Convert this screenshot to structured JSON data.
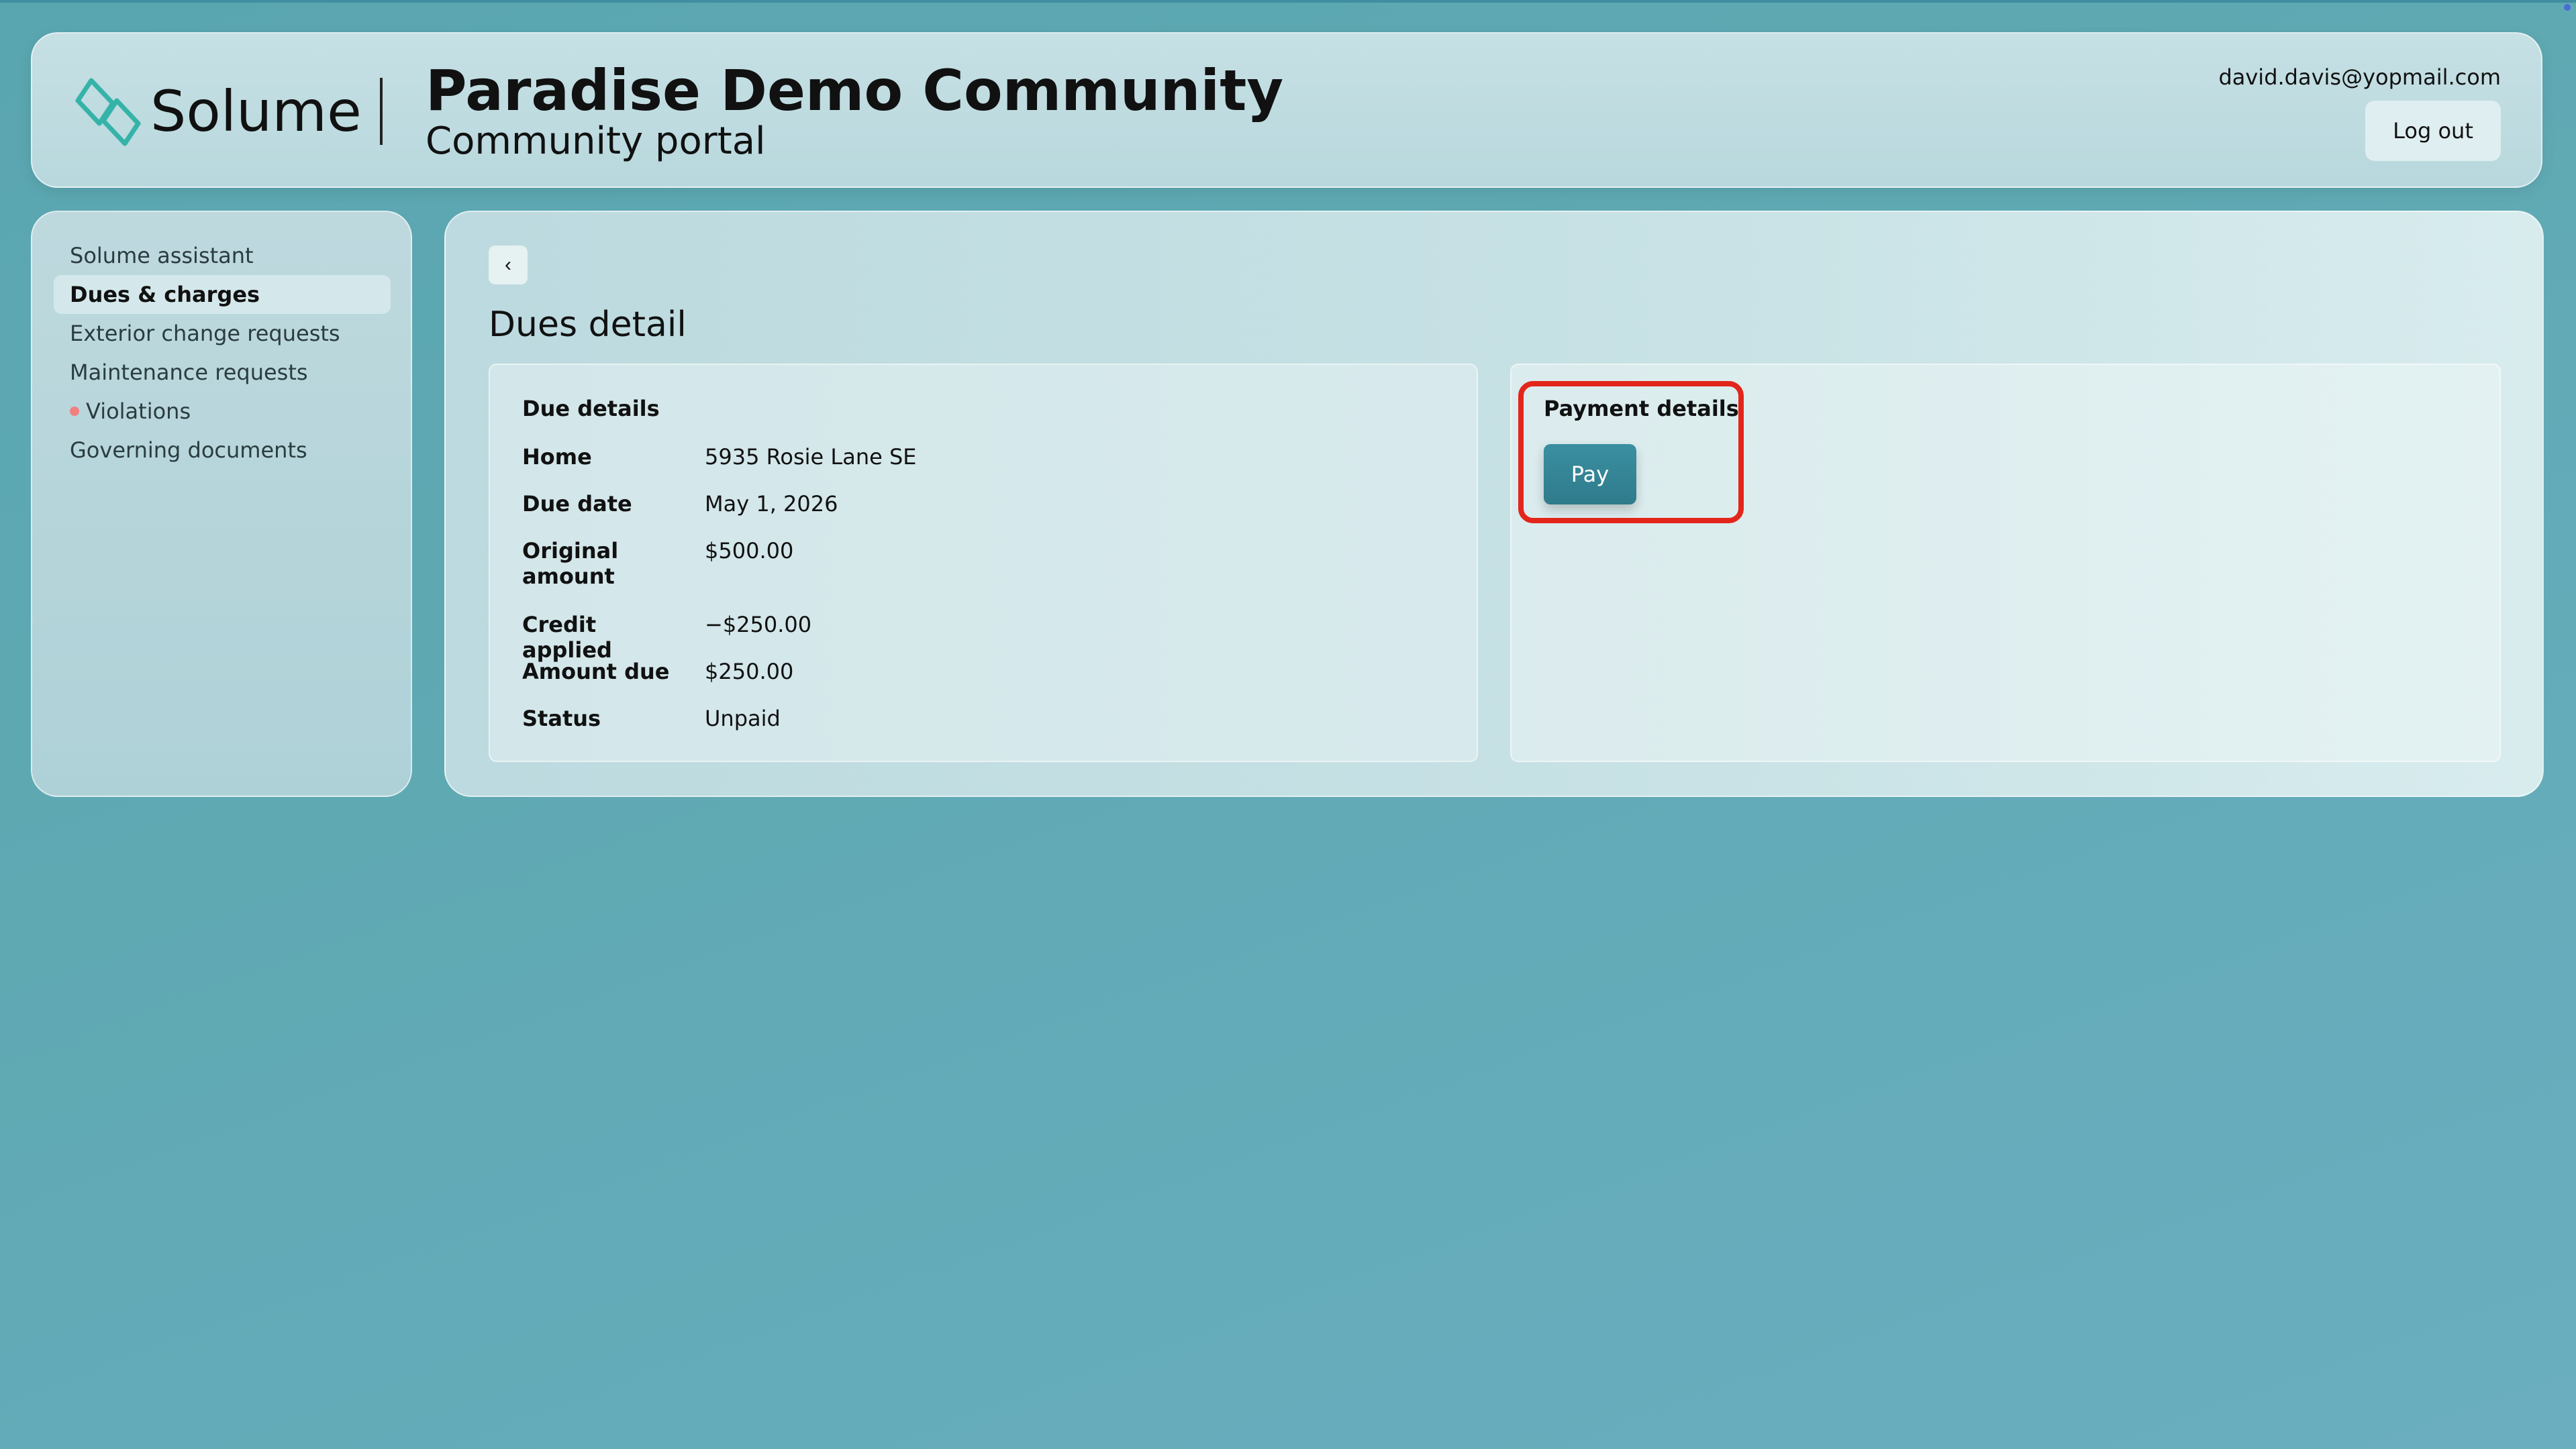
{
  "header": {
    "brand": "Solume",
    "title": "Paradise Demo Community",
    "subtitle": "Community portal",
    "email": "david.davis@yopmail.com",
    "logout_label": "Log out"
  },
  "sidebar": {
    "items": [
      {
        "label": "Solume assistant"
      },
      {
        "label": "Dues & charges"
      },
      {
        "label": "Exterior change requests"
      },
      {
        "label": "Maintenance requests"
      },
      {
        "label": "Violations"
      },
      {
        "label": "Governing documents"
      }
    ]
  },
  "main": {
    "back_label": "‹",
    "page_title": "Dues detail",
    "due_details": {
      "heading": "Due details",
      "rows": [
        {
          "label": "Home",
          "value": "5935 Rosie Lane SE"
        },
        {
          "label": "Due date",
          "value": "May 1, 2026"
        },
        {
          "label": "Original amount",
          "value": "$500.00"
        },
        {
          "label": "Credit applied",
          "value": "−$250.00"
        },
        {
          "label": "Amount due",
          "value": "$250.00"
        },
        {
          "label": "Status",
          "value": "Unpaid"
        }
      ]
    },
    "payment_details": {
      "heading": "Payment details",
      "pay_label": "Pay"
    }
  },
  "colors": {
    "accent": "#2f7b8c",
    "highlight": "#e3261b",
    "violation_badge": "#f08080"
  }
}
